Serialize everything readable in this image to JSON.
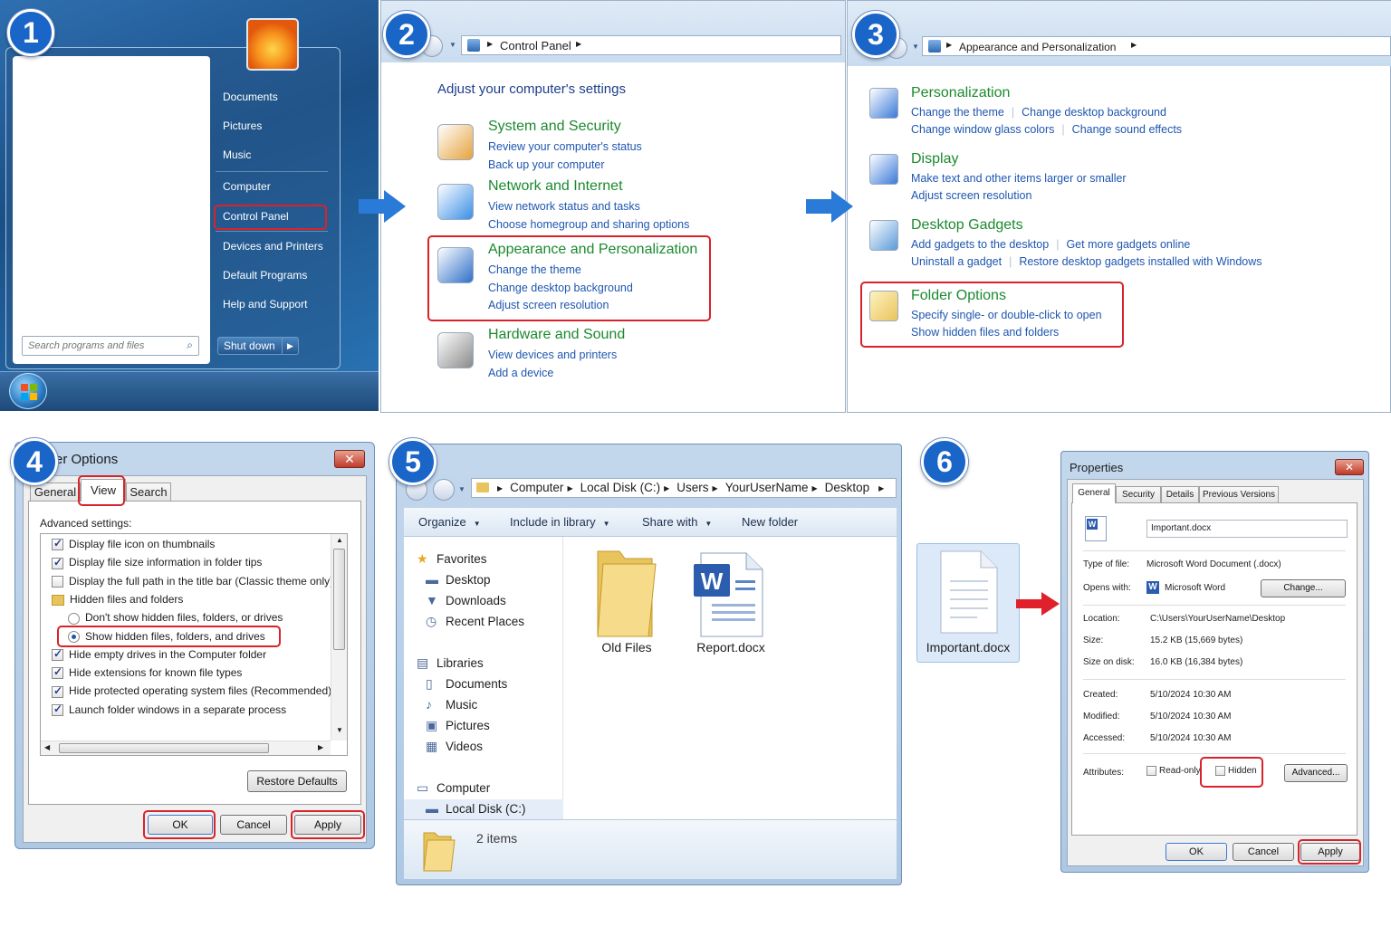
{
  "steps": [
    "1",
    "2",
    "3",
    "4",
    "5",
    "6"
  ],
  "panel1": {
    "menu_items": [
      "Documents",
      "Pictures",
      "Music",
      "Computer",
      "Control Panel",
      "Devices and Printers",
      "Default Programs",
      "Help and Support"
    ],
    "search_placeholder": "Search programs and files",
    "shutdown_label": "Shut down"
  },
  "panel2": {
    "breadcrumb": "Control Panel",
    "heading": "Adjust your computer's settings",
    "categories": [
      {
        "title": "System and Security",
        "links": [
          "Review your computer's status",
          "Back up your computer"
        ]
      },
      {
        "title": "Network and Internet",
        "links": [
          "View network status and tasks",
          "Choose homegroup and sharing options"
        ]
      },
      {
        "title": "Appearance and Personalization",
        "links": [
          "Change the theme",
          "Change desktop background",
          "Adjust screen resolution"
        ]
      },
      {
        "title": "Hardware and Sound",
        "links": [
          "View devices and printers",
          "Add a device"
        ]
      }
    ]
  },
  "panel3": {
    "breadcrumb": "Appearance and Personalization",
    "sections": [
      {
        "title": "Personalization",
        "row1": [
          "Change the theme",
          "Change desktop background"
        ],
        "row2": [
          "Change window glass colors",
          "Change sound effects"
        ]
      },
      {
        "title": "Display",
        "row1": [
          "Make text and other items larger or smaller"
        ],
        "row2": [
          "Adjust screen resolution"
        ]
      },
      {
        "title": "Desktop Gadgets",
        "row1": [
          "Add gadgets to the desktop",
          "Get more gadgets online"
        ],
        "row2": [
          "Uninstall a gadget",
          "Restore desktop gadgets installed with Windows"
        ]
      },
      {
        "title": "Folder Options",
        "row1": [
          "Specify single- or double-click to open"
        ],
        "row2": [
          "Show hidden files and folders"
        ]
      }
    ]
  },
  "panel4": {
    "title": "er Options",
    "tabs": [
      "General",
      "View",
      "Search"
    ],
    "advanced_label": "Advanced settings:",
    "items": [
      {
        "label": "Display file icon on thumbnails",
        "type": "check",
        "checked": true
      },
      {
        "label": "Display file size information in folder tips",
        "type": "check",
        "checked": true
      },
      {
        "label": "Display the full path in the title bar (Classic theme only)",
        "type": "check",
        "checked": false
      },
      {
        "label": "Hidden files and folders",
        "type": "folder",
        "checked": false
      },
      {
        "label": "Don't show hidden files, folders, or drives",
        "type": "radio",
        "checked": false
      },
      {
        "label": "Show hidden files, folders, and drives",
        "type": "radio",
        "checked": true
      },
      {
        "label": "Hide empty drives in the Computer folder",
        "type": "check",
        "checked": true
      },
      {
        "label": "Hide extensions for known file types",
        "type": "check",
        "checked": true
      },
      {
        "label": "Hide protected operating system files (Recommended)",
        "type": "check",
        "checked": true
      },
      {
        "label": "Launch folder windows in a separate process",
        "type": "check",
        "checked": true
      }
    ],
    "restore_label": "Restore Defaults",
    "ok_label": "OK",
    "cancel_label": "Cancel",
    "apply_label": "Apply"
  },
  "panel5": {
    "breadcrumb": [
      "Computer",
      "Local Disk (C:)",
      "Users",
      "YourUserName",
      "Desktop"
    ],
    "toolbar": [
      "Organize",
      "Include in library",
      "Share with",
      "New folder"
    ],
    "nav": [
      {
        "label": "Favorites",
        "icon": "star-icon",
        "indent": false
      },
      {
        "label": "Desktop",
        "icon": "desktop-icon",
        "indent": true
      },
      {
        "label": "Downloads",
        "icon": "downloads-icon",
        "indent": true
      },
      {
        "label": "Recent Places",
        "icon": "recent-places-icon",
        "indent": true
      },
      {
        "label": "Libraries",
        "icon": "libraries-icon",
        "indent": false
      },
      {
        "label": "Documents",
        "icon": "documents-icon",
        "indent": true
      },
      {
        "label": "Music",
        "icon": "music-icon",
        "indent": true
      },
      {
        "label": "Pictures",
        "icon": "pictures-icon",
        "indent": true
      },
      {
        "label": "Videos",
        "icon": "videos-icon",
        "indent": true
      },
      {
        "label": "Computer",
        "icon": "computer-icon",
        "indent": false
      },
      {
        "label": "Local Disk (C:)",
        "icon": "drive-icon",
        "indent": true
      }
    ],
    "files": [
      "Old Files",
      "Report.docx"
    ],
    "status": "2 items"
  },
  "panel6": {
    "file_label": "Important.docx",
    "title": "Properties",
    "tabs": [
      "General",
      "Security",
      "Details",
      "Previous Versions"
    ],
    "filename": "Important.docx",
    "type_label": "Type of file:",
    "type_value": "Microsoft Word Document (.docx)",
    "opens_label": "Opens with:",
    "opens_value": "Microsoft Word",
    "change_label": "Change...",
    "location_label": "Location:",
    "location_value": "C:\\Users\\YourUserName\\Desktop",
    "size_label": "Size:",
    "size_value": "15.2 KB (15,669 bytes)",
    "sizeondisk_label": "Size on disk:",
    "sizeondisk_value": "16.0 KB (16,384 bytes)",
    "created_label": "Created:",
    "created_value": "5/10/2024 10:30 AM",
    "modified_label": "Modified:",
    "modified_value": "5/10/2024 10:30 AM",
    "accessed_label": "Accessed:",
    "accessed_value": "5/10/2024 10:30 AM",
    "attributes_label": "Attributes:",
    "readonly_label": "Read-only",
    "hidden_label": "Hidden",
    "advanced_label": "Advanced...",
    "ok_label": "OK",
    "cancel_label": "Cancel",
    "apply_label": "Apply"
  }
}
